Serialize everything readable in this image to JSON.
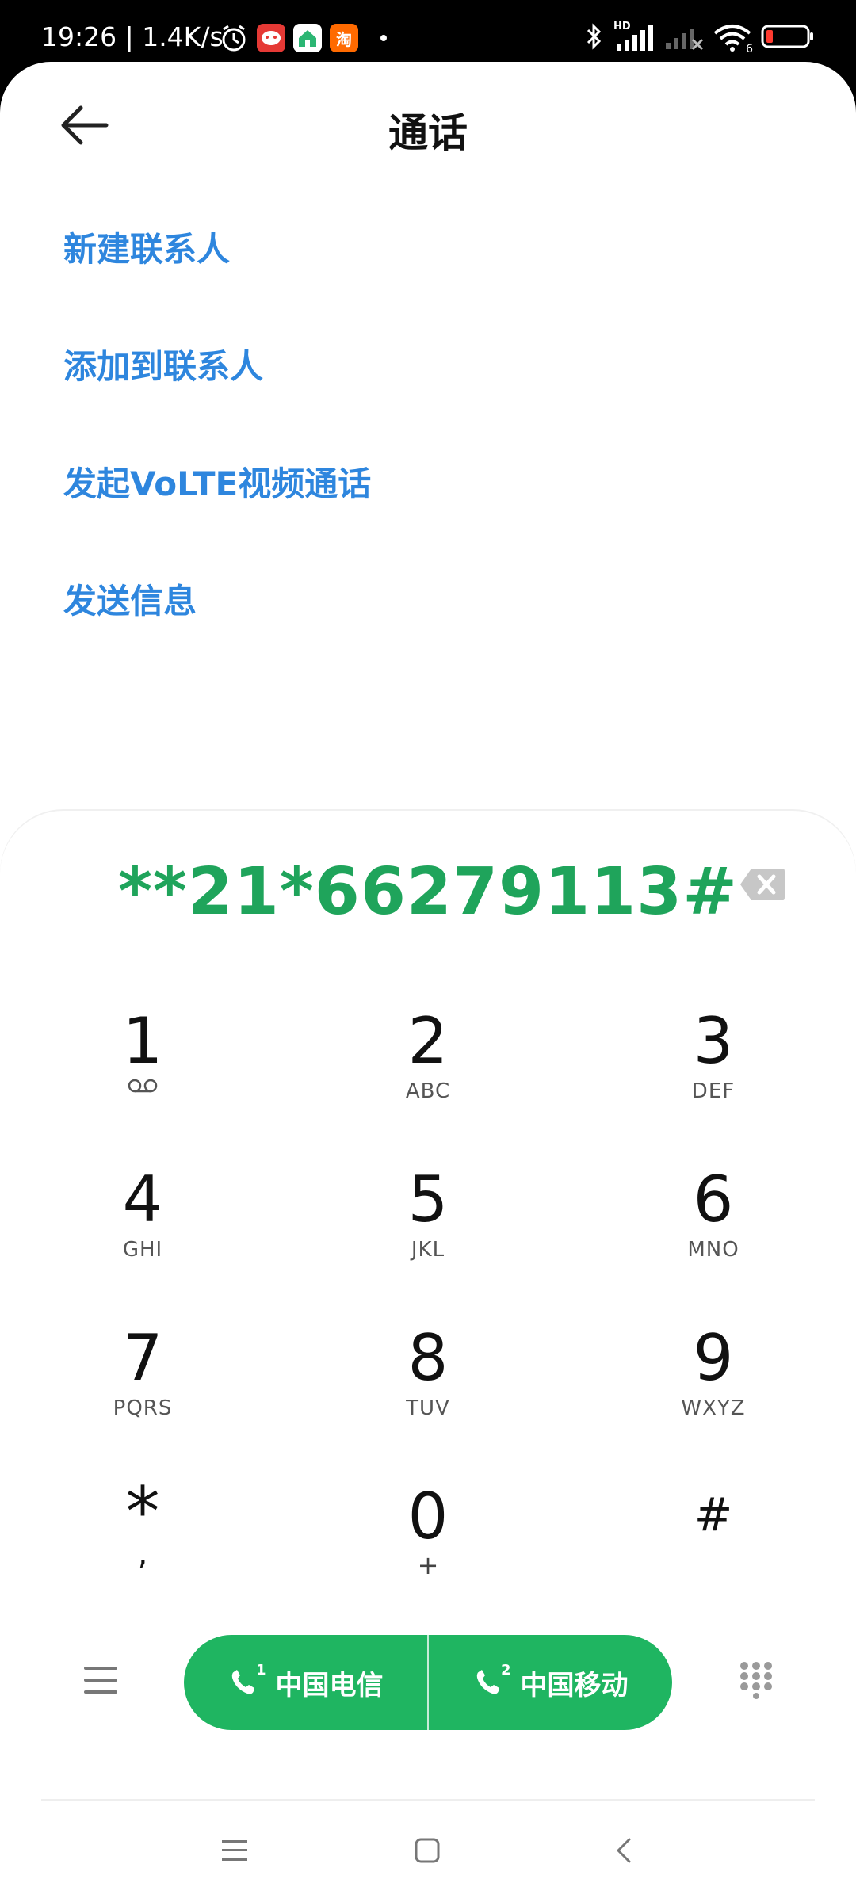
{
  "status_bar": {
    "time": "19:26 | 1.4K/s",
    "apps": [
      "alarm-icon",
      "app-red-icon",
      "app-green-home-icon",
      "taobao-icon"
    ],
    "taobao_label": "淘",
    "hd_label": "HD",
    "wifi_label": "6",
    "right_icons": [
      "bluetooth-icon",
      "signal-hd-icon",
      "signal-x-icon",
      "wifi-icon",
      "battery-icon"
    ]
  },
  "header": {
    "title": "通话",
    "back_icon": "arrow-left-icon"
  },
  "menu": {
    "items": [
      {
        "label": "新建联系人"
      },
      {
        "label": "添加到联系人"
      },
      {
        "label": "发起VoLTE视频通话"
      },
      {
        "label": "发送信息"
      }
    ]
  },
  "dialer": {
    "number": "**21*66279113#",
    "backspace_icon": "backspace-icon",
    "keys": [
      {
        "digit": "1",
        "letters": "voicemail-icon"
      },
      {
        "digit": "2",
        "letters": "ABC"
      },
      {
        "digit": "3",
        "letters": "DEF"
      },
      {
        "digit": "4",
        "letters": "GHI"
      },
      {
        "digit": "5",
        "letters": "JKL"
      },
      {
        "digit": "6",
        "letters": "MNO"
      },
      {
        "digit": "7",
        "letters": "PQRS"
      },
      {
        "digit": "8",
        "letters": "TUV"
      },
      {
        "digit": "9",
        "letters": "WXYZ"
      },
      {
        "digit": "*",
        "letters": ","
      },
      {
        "digit": "0",
        "letters": "+"
      },
      {
        "digit": "#",
        "letters": ""
      }
    ]
  },
  "actions": {
    "sim1_label": "中国电信",
    "sim2_label": "中国移动",
    "sim1_badge": "1",
    "sim2_badge": "2",
    "accent": "#1fb561",
    "link_color": "#2e86de",
    "number_color": "#1fa45b"
  },
  "navbar": {
    "icons": [
      "nav-recents-icon",
      "nav-home-icon",
      "nav-back-icon"
    ]
  }
}
